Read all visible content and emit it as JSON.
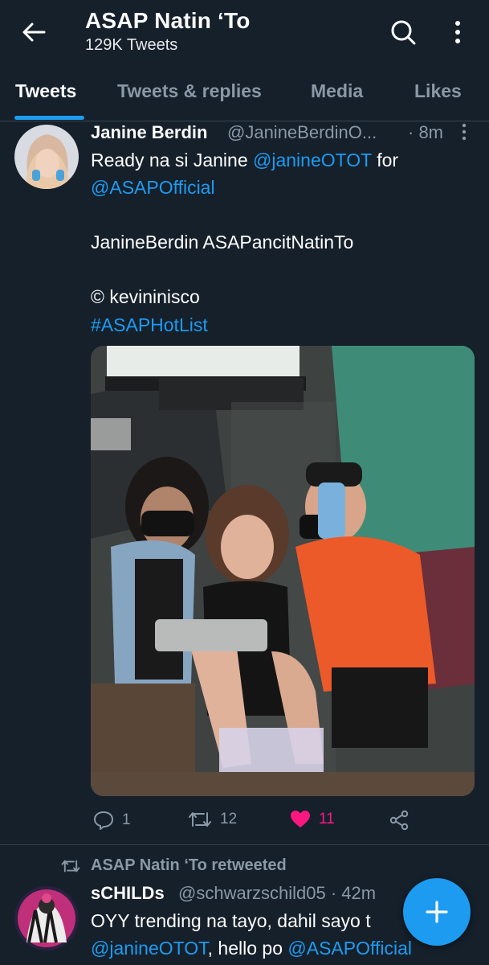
{
  "header": {
    "title": "ASAP Natin ‘To",
    "subtitle": "129K Tweets",
    "back_icon": "arrow-left-icon",
    "search_icon": "search-icon",
    "more_icon": "more-vertical-icon"
  },
  "tabs": [
    {
      "label": "Tweets",
      "active": true
    },
    {
      "label": "Tweets & replies",
      "active": false
    },
    {
      "label": "Media",
      "active": false
    },
    {
      "label": "Likes",
      "active": false
    }
  ],
  "tweet1": {
    "name": "Janine Berdin",
    "handle": "@JanineBerdinO...",
    "time": "· 8m",
    "line1_text": "Ready na si Janine ",
    "line1_link": "@janineOTOT",
    "line1_after": " for",
    "line2_link": "@ASAPOfficial",
    "line3": "JanineBerdin ASAPancitNatinTo",
    "line4": "© kevininisco",
    "line5_link": "#ASAPHotList",
    "actions": {
      "reply_count": "1",
      "retweet_count": "12",
      "like_count": "11",
      "like_color": "#f91880"
    }
  },
  "tweet2": {
    "retweeted_by": "ASAP Natin ‘To retweeted",
    "name": "sCHILDs",
    "handle": "@schwarzschild05 · 42m",
    "line1": "OYY trending na tayo, dahil sayo t",
    "line2_link1": "@janineOTOT",
    "line2_mid": ", hello po ",
    "line2_link2": "@ASAPOfficial"
  },
  "fab": {
    "icon": "plus-icon"
  },
  "colors": {
    "background": "#15202b",
    "accent": "#1d9bf0",
    "muted": "#8b98a5",
    "like": "#f91880"
  }
}
